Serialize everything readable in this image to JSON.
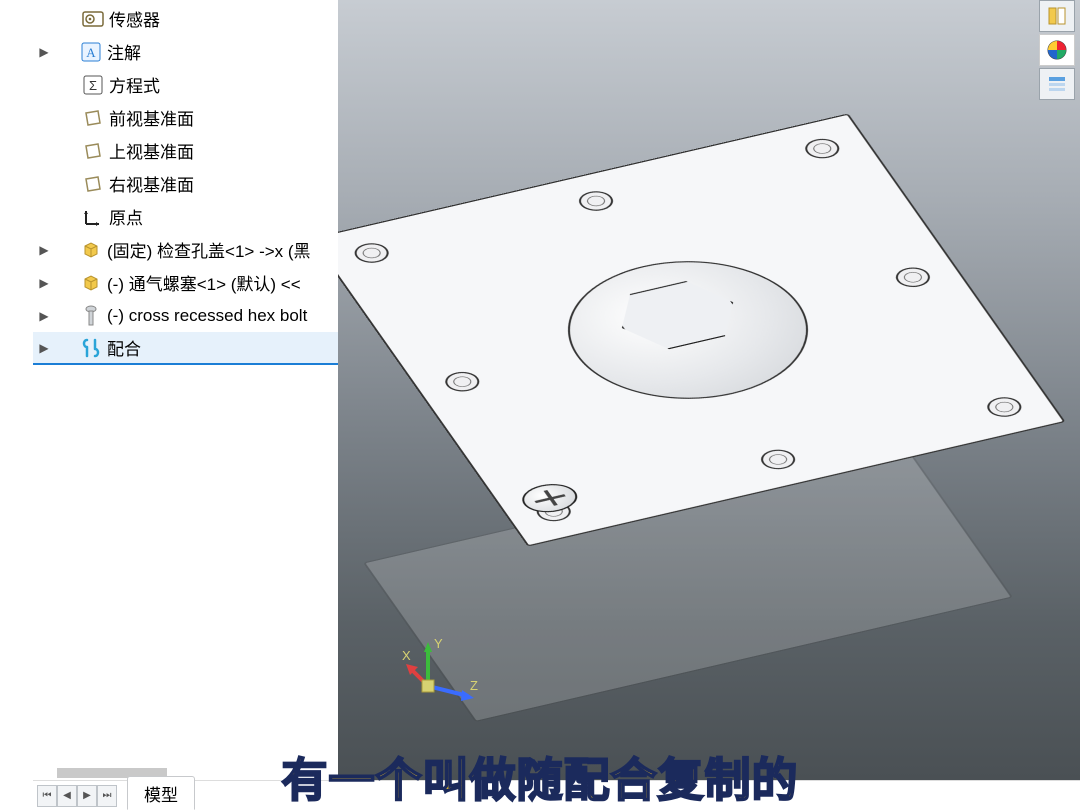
{
  "tree": {
    "items": [
      {
        "icon": "sensor-icon",
        "label": "传感器",
        "expand": "none"
      },
      {
        "icon": "annotation-icon",
        "label": "注解",
        "expand": "closed"
      },
      {
        "icon": "equation-icon",
        "label": "方程式",
        "expand": "none"
      },
      {
        "icon": "plane-icon",
        "label": "前视基准面",
        "expand": "none"
      },
      {
        "icon": "plane-icon",
        "label": "上视基准面",
        "expand": "none"
      },
      {
        "icon": "plane-icon",
        "label": "右视基准面",
        "expand": "none"
      },
      {
        "icon": "origin-icon",
        "label": "原点",
        "expand": "none"
      },
      {
        "icon": "part-icon",
        "label": "(固定) 检查孔盖<1> ->x (黑",
        "expand": "closed"
      },
      {
        "icon": "part-icon",
        "label": "(-) 通气螺塞<1> (默认) <<",
        "expand": "closed"
      },
      {
        "icon": "fastener-icon",
        "label": "(-) cross recessed hex bolt",
        "expand": "closed"
      },
      {
        "icon": "mates-icon",
        "label": "配合",
        "expand": "closed",
        "selected": true
      }
    ]
  },
  "side_tools": [
    "feature-manager-icon",
    "appearance-icon",
    "display-pane-icon"
  ],
  "triad": {
    "axes": [
      "X",
      "Y",
      "Z"
    ]
  },
  "tabs": {
    "nav": [
      "first",
      "prev",
      "next",
      "last"
    ],
    "items": [
      {
        "label": "模型",
        "active": true
      }
    ]
  },
  "subtitle": "有一个叫做随配合复制的"
}
